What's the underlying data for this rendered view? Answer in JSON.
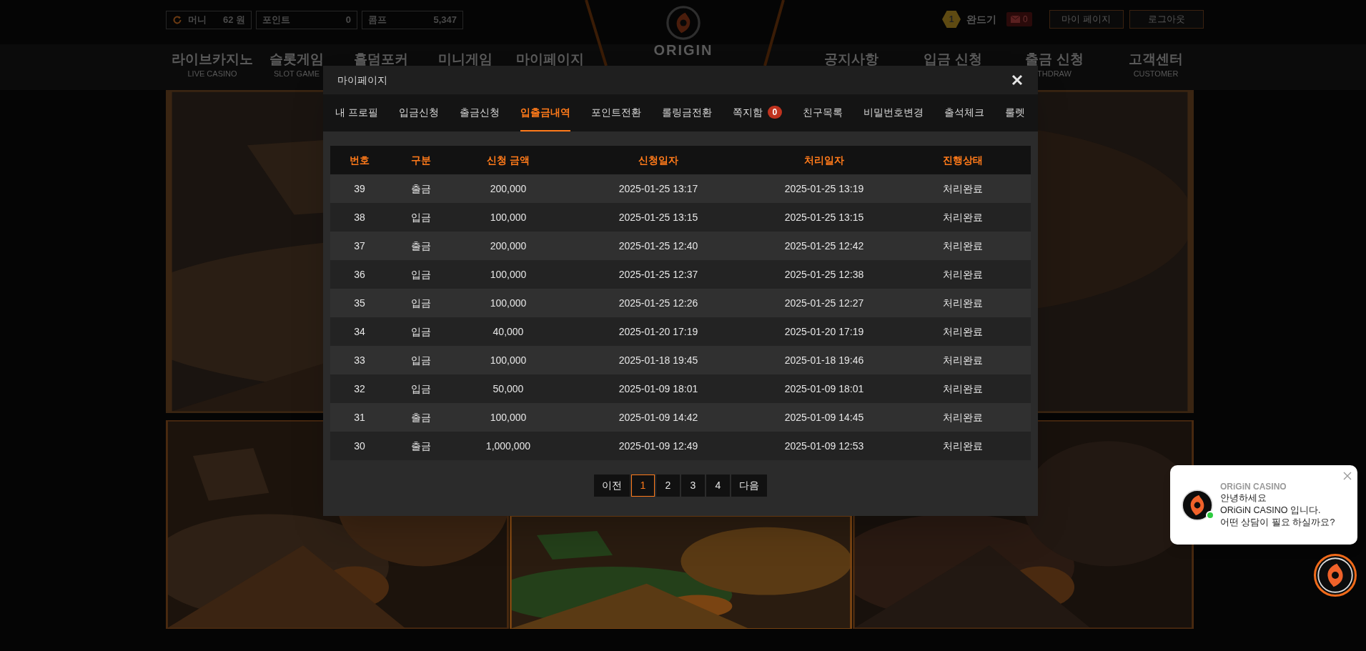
{
  "top_bar": {
    "wallet": [
      {
        "kind": "refresh",
        "label": "머니",
        "value": "62 원"
      },
      {
        "kind": "plain",
        "label": "포인트",
        "value": "0"
      },
      {
        "kind": "plain",
        "label": "콤프",
        "value": "5,347"
      }
    ],
    "logo_text": "ORIGIN",
    "level": "1",
    "username": "완드기",
    "messages": "0",
    "buttons": [
      "마이 페이지",
      "로그아웃"
    ]
  },
  "nav_left": [
    {
      "label": "라이브카지노",
      "sub": "LIVE CASINO"
    },
    {
      "label": "슬롯게임",
      "sub": "SLOT GAME"
    },
    {
      "label": "홀덤포커"
    },
    {
      "label": "미니게임"
    },
    {
      "label": "마이페이지"
    }
  ],
  "nav_right": [
    {
      "label": "공지사항"
    },
    {
      "label": "입금 신청"
    },
    {
      "label": "출금 신청",
      "sub": "THDRAW"
    },
    {
      "label": "고객센터",
      "sub": "CUSTOMER"
    }
  ],
  "modal": {
    "title": "마이페이지",
    "tabs": [
      {
        "label": "내 프로필",
        "selected": false
      },
      {
        "label": "입금신청",
        "selected": false
      },
      {
        "label": "출금신청",
        "selected": false
      },
      {
        "label": "입출금내역",
        "selected": true
      },
      {
        "label": "포인트전환",
        "selected": false
      },
      {
        "label": "롤링금전환",
        "selected": false
      },
      {
        "label": "쪽지함",
        "selected": false,
        "badge": "0"
      },
      {
        "label": "친구목록",
        "selected": false
      },
      {
        "label": "비밀번호변경",
        "selected": false
      },
      {
        "label": "출석체크",
        "selected": false
      },
      {
        "label": "룰렛",
        "selected": false
      }
    ],
    "table": {
      "columns": [
        "번호",
        "구분",
        "신청 금액",
        "신청일자",
        "처리일자",
        "진행상태"
      ],
      "rows": [
        [
          "39",
          "출금",
          "200,000",
          "2025-01-25 13:17",
          "2025-01-25 13:19",
          "처리완료"
        ],
        [
          "38",
          "입금",
          "100,000",
          "2025-01-25 13:15",
          "2025-01-25 13:15",
          "처리완료"
        ],
        [
          "37",
          "출금",
          "200,000",
          "2025-01-25 12:40",
          "2025-01-25 12:42",
          "처리완료"
        ],
        [
          "36",
          "입금",
          "100,000",
          "2025-01-25 12:37",
          "2025-01-25 12:38",
          "처리완료"
        ],
        [
          "35",
          "입금",
          "100,000",
          "2025-01-25 12:26",
          "2025-01-25 12:27",
          "처리완료"
        ],
        [
          "34",
          "입금",
          "40,000",
          "2025-01-20 17:19",
          "2025-01-20 17:19",
          "처리완료"
        ],
        [
          "33",
          "입금",
          "100,000",
          "2025-01-18 19:45",
          "2025-01-18 19:46",
          "처리완료"
        ],
        [
          "32",
          "입금",
          "50,000",
          "2025-01-09 18:01",
          "2025-01-09 18:01",
          "처리완료"
        ],
        [
          "31",
          "출금",
          "100,000",
          "2025-01-09 14:42",
          "2025-01-09 14:45",
          "처리완료"
        ],
        [
          "30",
          "출금",
          "1,000,000",
          "2025-01-09 12:49",
          "2025-01-09 12:53",
          "처리완료"
        ]
      ]
    },
    "pagination": {
      "prev": "이전",
      "next": "다음",
      "pages": [
        {
          "label": "1",
          "selected": true
        },
        {
          "label": "2",
          "selected": false
        },
        {
          "label": "3",
          "selected": false
        },
        {
          "label": "4",
          "selected": false
        }
      ]
    }
  },
  "chat": {
    "sender": "ORiGiN CASINO",
    "online": true,
    "lines": [
      "안녕하세요",
      "ORiGiN CASINO 입니다.",
      "어떤 상담이 필요 하실까요?"
    ]
  }
}
